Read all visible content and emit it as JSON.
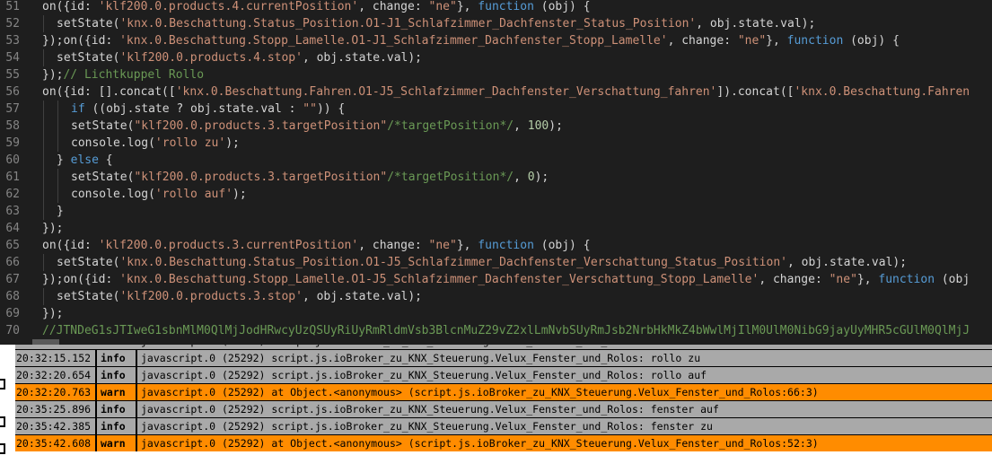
{
  "editor": {
    "lines": [
      {
        "n": "51",
        "indent": 0,
        "tokens": [
          [
            "fn",
            "on({id: "
          ],
          [
            "str",
            "'klf200.0.products.4.currentPosition'"
          ],
          [
            "fn",
            ", change: "
          ],
          [
            "str",
            "\"ne\""
          ],
          [
            "fn",
            "}, "
          ],
          [
            "kw",
            "function"
          ],
          [
            "fn",
            " (obj) {"
          ]
        ]
      },
      {
        "n": "52",
        "indent": 1,
        "tokens": [
          [
            "fn",
            "setState("
          ],
          [
            "str",
            "'knx.0.Beschattung.Status_Position.O1-J1_Schlafzimmer_Dachfenster_Status_Position'"
          ],
          [
            "fn",
            ", obj.state.val);"
          ]
        ]
      },
      {
        "n": "53",
        "indent": 0,
        "tokens": [
          [
            "fn",
            "});on({id: "
          ],
          [
            "str",
            "'knx.0.Beschattung.Stopp_Lamelle.O1-J1_Schlafzimmer_Dachfenster_Stopp_Lamelle'"
          ],
          [
            "fn",
            ", change: "
          ],
          [
            "str",
            "\"ne\""
          ],
          [
            "fn",
            "}, "
          ],
          [
            "kw",
            "function"
          ],
          [
            "fn",
            " (obj) {"
          ]
        ]
      },
      {
        "n": "54",
        "indent": 1,
        "tokens": [
          [
            "fn",
            "setState("
          ],
          [
            "str",
            "'klf200.0.products.4.stop'"
          ],
          [
            "fn",
            ", obj.state.val);"
          ]
        ]
      },
      {
        "n": "55",
        "indent": 0,
        "tokens": [
          [
            "fn",
            "});"
          ],
          [
            "cmt",
            "// Lichtkuppel Rollo"
          ]
        ]
      },
      {
        "n": "56",
        "indent": 0,
        "tokens": [
          [
            "fn",
            "on({id: [].concat(["
          ],
          [
            "str",
            "'knx.0.Beschattung.Fahren.O1-J5_Schlafzimmer_Dachfenster_Verschattung_fahren'"
          ],
          [
            "fn",
            "]).concat(["
          ],
          [
            "str",
            "'knx.0.Beschattung.Fahren"
          ]
        ]
      },
      {
        "n": "57",
        "indent": 2,
        "tokens": [
          [
            "kw",
            "if"
          ],
          [
            "fn",
            " ((obj.state ? obj.state.val : "
          ],
          [
            "str",
            "\"\""
          ],
          [
            "fn",
            ")) {"
          ]
        ]
      },
      {
        "n": "58",
        "indent": 2,
        "tokens": [
          [
            "fn",
            "setState("
          ],
          [
            "str",
            "\"klf200.0.products.3.targetPosition\""
          ],
          [
            "cmt",
            "/*targetPosition*/"
          ],
          [
            "fn",
            ", "
          ],
          [
            "num",
            "100"
          ],
          [
            "fn",
            ");"
          ]
        ]
      },
      {
        "n": "59",
        "indent": 2,
        "tokens": [
          [
            "fn",
            "console.log("
          ],
          [
            "str",
            "'rollo zu'"
          ],
          [
            "fn",
            ");"
          ]
        ]
      },
      {
        "n": "60",
        "indent": 1,
        "tokens": [
          [
            "fn",
            "} "
          ],
          [
            "kw",
            "else"
          ],
          [
            "fn",
            " {"
          ]
        ]
      },
      {
        "n": "61",
        "indent": 2,
        "tokens": [
          [
            "fn",
            "setState("
          ],
          [
            "str",
            "\"klf200.0.products.3.targetPosition\""
          ],
          [
            "cmt",
            "/*targetPosition*/"
          ],
          [
            "fn",
            ", "
          ],
          [
            "num",
            "0"
          ],
          [
            "fn",
            ");"
          ]
        ]
      },
      {
        "n": "62",
        "indent": 2,
        "tokens": [
          [
            "fn",
            "console.log("
          ],
          [
            "str",
            "'rollo auf'"
          ],
          [
            "fn",
            ");"
          ]
        ]
      },
      {
        "n": "63",
        "indent": 1,
        "tokens": [
          [
            "fn",
            "}"
          ]
        ]
      },
      {
        "n": "64",
        "indent": 0,
        "tokens": [
          [
            "fn",
            "});"
          ]
        ]
      },
      {
        "n": "65",
        "indent": 0,
        "tokens": [
          [
            "fn",
            "on({id: "
          ],
          [
            "str",
            "'klf200.0.products.3.currentPosition'"
          ],
          [
            "fn",
            ", change: "
          ],
          [
            "str",
            "\"ne\""
          ],
          [
            "fn",
            "}, "
          ],
          [
            "kw",
            "function"
          ],
          [
            "fn",
            " (obj) {"
          ]
        ]
      },
      {
        "n": "66",
        "indent": 1,
        "tokens": [
          [
            "fn",
            "setState("
          ],
          [
            "str",
            "'knx.0.Beschattung.Status_Position.O1-J5_Schlafzimmer_Dachfenster_Verschattung_Status_Position'"
          ],
          [
            "fn",
            ", obj.state.val);"
          ]
        ]
      },
      {
        "n": "67",
        "indent": 0,
        "tokens": [
          [
            "fn",
            "});on({id: "
          ],
          [
            "str",
            "'knx.0.Beschattung.Stopp_Lamelle.O1-J5_Schlafzimmer_Dachfenster_Verschattung_Stopp_Lamelle'"
          ],
          [
            "fn",
            ", change: "
          ],
          [
            "str",
            "\"ne\""
          ],
          [
            "fn",
            "}, "
          ],
          [
            "kw",
            "function"
          ],
          [
            "fn",
            " (obj"
          ]
        ]
      },
      {
        "n": "68",
        "indent": 1,
        "tokens": [
          [
            "fn",
            "setState("
          ],
          [
            "str",
            "'klf200.0.products.3.stop'"
          ],
          [
            "fn",
            ", obj.state.val);"
          ]
        ]
      },
      {
        "n": "69",
        "indent": 0,
        "tokens": [
          [
            "fn",
            "});"
          ]
        ]
      },
      {
        "n": "70",
        "indent": 0,
        "tokens": [
          [
            "cmt",
            "//JTNDeG1sJTIweG1sbnMlM0QlMjJodHRwcyUzQSUyRiUyRmRldmVsb3BlcnMuZ29vZ2xlLmNvbSUyRmJsb2NrbHkMkZ4bWwlMjIlM0UlM0NibG9jayUyMHR5cGUlM0QlMjJ"
          ]
        ]
      }
    ]
  },
  "log": {
    "rows": [
      {
        "time": "20:32:15.152",
        "level": "info",
        "msg": "javascript.0 (25292) script.js.ioBroker_zu_KNX_Steuerung.Velux_Fenster_und_Rolos: rollo zu"
      },
      {
        "time": "20:32:20.654",
        "level": "info",
        "msg": "javascript.0 (25292) script.js.ioBroker_zu_KNX_Steuerung.Velux_Fenster_und_Rolos: rollo auf"
      },
      {
        "time": "20:32:20.763",
        "level": "warn",
        "msg": "javascript.0 (25292) at Object.<anonymous> (script.js.ioBroker_zu_KNX_Steuerung.Velux_Fenster_und_Rolos:66:3)"
      },
      {
        "time": "20:35:25.896",
        "level": "info",
        "msg": "javascript.0 (25292) script.js.ioBroker_zu_KNX_Steuerung.Velux_Fenster_und_Rolos: fenster auf"
      },
      {
        "time": "20:35:42.385",
        "level": "info",
        "msg": "javascript.0 (25292) script.js.ioBroker_zu_KNX_Steuerung.Velux_Fenster_und_Rolos: fenster zu"
      },
      {
        "time": "20:35:42.608",
        "level": "warn",
        "msg": "javascript.0 (25292) at Object.<anonymous> (script.js.ioBroker_zu_KNX_Steuerung.Velux_Fenster_und_Rolos:52:3)"
      }
    ],
    "partial_top": {
      "time": "20:32:10.xxx",
      "level": "info",
      "msg": "javascript.0 (25292) script.js.ioBroker_zu_KNX_Steuerung.Velux_Fenster_und_Rolos: rollo auf"
    }
  },
  "colors": {
    "info_row": "#a9a9a9",
    "warn_row": "#ff8c00",
    "editor_bg": "#1e1e1e",
    "string": "#ce9178",
    "keyword": "#569cd6",
    "comment": "#6a9955",
    "number": "#b5cea8"
  }
}
